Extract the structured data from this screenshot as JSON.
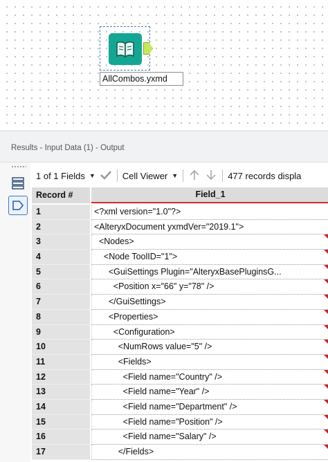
{
  "canvas": {
    "tool": {
      "label": "AllCombos.yxmd",
      "icon": "book-icon"
    }
  },
  "results": {
    "title": "Results - Input Data (1) - Output"
  },
  "toolbar": {
    "fields_selector": "1 of 1 Fields",
    "view_selector": "Cell Viewer",
    "records_text": "477 records displa"
  },
  "grid": {
    "header": {
      "record": "Record #",
      "field": "Field_1"
    },
    "rows": [
      {
        "num": "1",
        "value": "<?xml version=\"1.0\"?>",
        "truncated": false
      },
      {
        "num": "2",
        "value": "<AlteryxDocument yxmdVer=\"2019.1\">",
        "truncated": false
      },
      {
        "num": "3",
        "value": "  <Nodes>",
        "truncated": true
      },
      {
        "num": "4",
        "value": "    <Node ToolID=\"1\">",
        "truncated": true
      },
      {
        "num": "5",
        "value": "      <GuiSettings Plugin=\"AlteryxBasePluginsG...",
        "truncated": true
      },
      {
        "num": "6",
        "value": "        <Position x=\"66\" y=\"78\" />",
        "truncated": true
      },
      {
        "num": "7",
        "value": "      </GuiSettings>",
        "truncated": true
      },
      {
        "num": "8",
        "value": "      <Properties>",
        "truncated": true
      },
      {
        "num": "9",
        "value": "        <Configuration>",
        "truncated": true
      },
      {
        "num": "10",
        "value": "          <NumRows value=\"5\" />",
        "truncated": true
      },
      {
        "num": "11",
        "value": "          <Fields>",
        "truncated": true
      },
      {
        "num": "12",
        "value": "            <Field name=\"Country\" />",
        "truncated": true
      },
      {
        "num": "13",
        "value": "            <Field name=\"Year\" />",
        "truncated": true
      },
      {
        "num": "14",
        "value": "            <Field name=\"Department\" />",
        "truncated": true
      },
      {
        "num": "15",
        "value": "            <Field name=\"Position\" />",
        "truncated": true
      },
      {
        "num": "16",
        "value": "            <Field name=\"Salary\" />",
        "truncated": true
      },
      {
        "num": "17",
        "value": "          </Fields>",
        "truncated": true
      }
    ]
  },
  "colors": {
    "tool_teal": "#15a693",
    "anchor_green": "#c4e85a",
    "header_red": "#d8282d",
    "accent_blue": "#3b77c4"
  }
}
